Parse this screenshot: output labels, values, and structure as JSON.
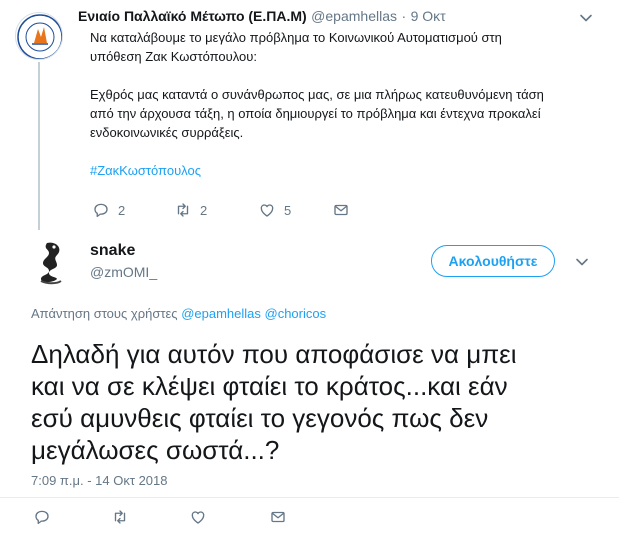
{
  "parent_tweet": {
    "display_name": "Ενιαίο Παλλαϊκό Μέτωπο (Ε.ΠΑ.Μ)",
    "handle": "@epamhellas",
    "separator": "·",
    "date": "9 Οκτ",
    "text_line1": "Να καταλάβουμε το μεγάλο πρόβλημα το Κοινωνικού Αυτοματισμού στη",
    "text_line2": "υπόθεση Ζακ Κωστόπουλου:",
    "text_line3": "Εχθρός μας καταντά ο συνάνθρωπος μας, σε μια πλήρως κατευθυνόμενη τάση",
    "text_line4": "από την άρχουσα τάξη, η οποία δημιουργεί το πρόβλημα και έντεχνα προκαλεί",
    "text_line5": "ενδοκοινωνικές συρράξεις.",
    "hashtag": "#ΖακΚωστόπουλος",
    "replies": "2",
    "retweets": "2",
    "likes": "5",
    "avatar_text": "ΕΝΙΑΙΟ ΠΑΛΛΑΪΚΟ ΜΕΤΩΠΟ",
    "avatar_abbr": "Ε.ΠΑ.Μ"
  },
  "main_tweet": {
    "display_name": "snake",
    "handle": "@zmOMI_",
    "follow_label": "Ακολουθήστε",
    "reply_prefix": "Απάντηση στους χρήστες",
    "mention1": "@epamhellas",
    "mention2": "@choricos",
    "text_line1": "Δηλαδή για αυτόν που αποφάσισε να μπει",
    "text_line2": "και να σε κλέψει φταίει το κράτος...και εάν",
    "text_line3": "εσύ αμυνθεις φταίει το γεγονός πως δεν",
    "text_line4": "μεγάλωσες σωστά...?",
    "timestamp": "7:09 π.μ. - 14 Οκτ 2018"
  },
  "icons": {
    "reply": "reply-icon",
    "retweet": "retweet-icon",
    "like": "heart-icon",
    "dm": "envelope-icon",
    "caret": "chevron-down-icon"
  },
  "colors": {
    "accent": "#1da1f2",
    "secondary_text": "#657786",
    "primary_text": "#14171a",
    "thread_line": "#c4cfd6"
  }
}
